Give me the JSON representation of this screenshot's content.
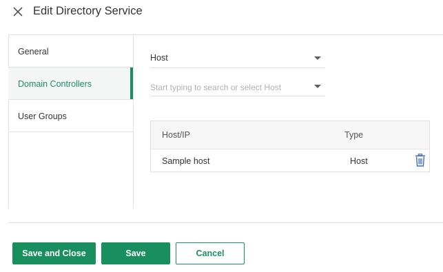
{
  "dialog": {
    "title": "Edit Directory Service",
    "close_icon": "close-icon"
  },
  "sidebar": {
    "items": [
      {
        "label": "General",
        "active": false
      },
      {
        "label": "Domain Controllers",
        "active": true
      },
      {
        "label": "User Groups",
        "active": false
      }
    ]
  },
  "form": {
    "type_select": {
      "value": "Host"
    },
    "host_select": {
      "placeholder": "Start typing to search or select Host"
    }
  },
  "table": {
    "columns": [
      "Host/IP",
      "Type"
    ],
    "rows": [
      {
        "host": "Sample host",
        "type": "Host",
        "action_icon": "trash-icon"
      }
    ]
  },
  "footer": {
    "save_close_label": "Save and Close",
    "save_label": "Save",
    "cancel_label": "Cancel"
  },
  "colors": {
    "accent": "#198e5f",
    "delete_icon": "#3f6fb0",
    "border": "#e0e0e0"
  }
}
